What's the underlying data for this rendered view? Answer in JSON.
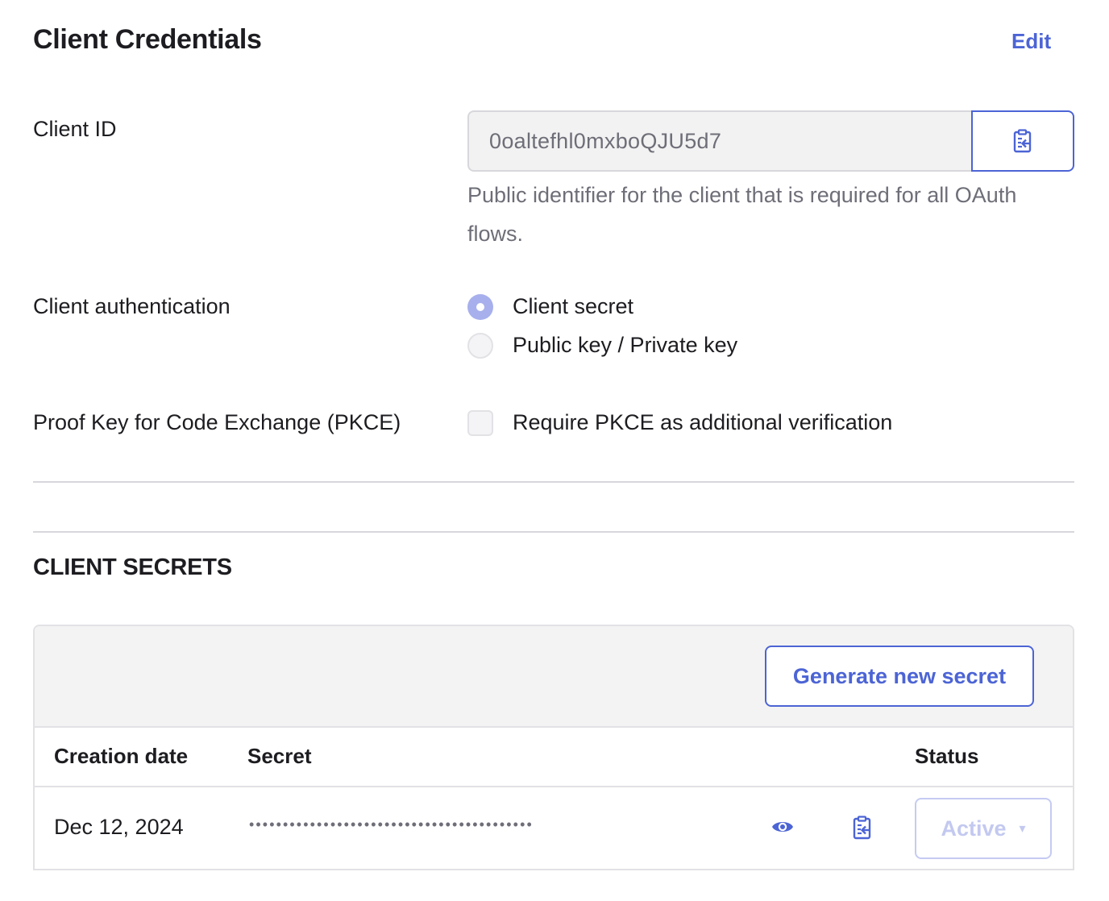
{
  "header": {
    "title": "Client Credentials",
    "edit_label": "Edit"
  },
  "client_id": {
    "label": "Client ID",
    "value": "0oaltefhl0mxboQJU5d7",
    "help_text": "Public identifier for the client that is required for all OAuth flows.",
    "copy_icon": "clipboard-copy-icon"
  },
  "client_auth": {
    "label": "Client authentication",
    "options": [
      {
        "label": "Client secret",
        "checked": true
      },
      {
        "label": "Public key / Private key",
        "checked": false
      }
    ]
  },
  "pkce": {
    "label": "Proof Key for Code Exchange (PKCE)",
    "checkbox_label": "Require PKCE as additional verification",
    "checked": false
  },
  "client_secrets": {
    "title": "CLIENT SECRETS",
    "generate_label": "Generate new secret",
    "columns": [
      "Creation date",
      "Secret",
      "Status"
    ],
    "rows": [
      {
        "creation_date": "Dec 12, 2024",
        "secret_masked": "••••••••••••••••••••••••••••••••••••••••••",
        "status": "Active",
        "caret": "▾",
        "reveal_icon": "eye-icon",
        "copy_icon": "clipboard-copy-icon"
      }
    ]
  },
  "colors": {
    "accent": "#4c64d5",
    "muted_text": "#6e6e78",
    "disabled_accent": "#c3c9f0"
  }
}
